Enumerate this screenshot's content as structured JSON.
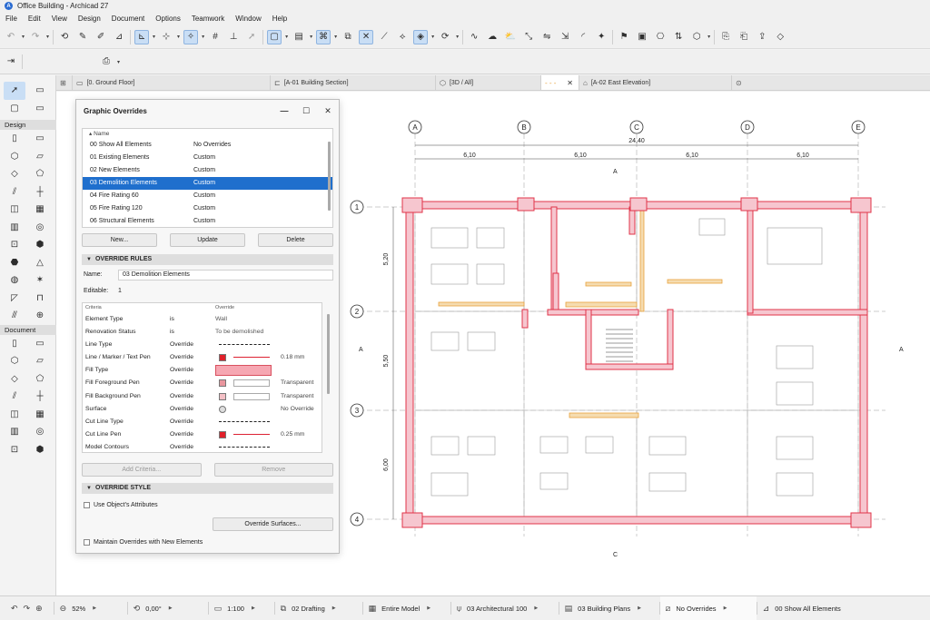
{
  "window": {
    "title": "Office Building - Archicad 27",
    "app_letter": "A"
  },
  "menu": [
    "File",
    "Edit",
    "View",
    "Design",
    "Document",
    "Options",
    "Teamwork",
    "Window",
    "Help"
  ],
  "toolbox": {
    "design_label": "Design",
    "document_label": "Document",
    "icons_top": [
      "arrow-pointer-icon",
      "marquee-icon",
      "rect-select-icon",
      "rect-select-alt-icon"
    ],
    "icons_design": [
      "wall-icon",
      "column-icon",
      "beam-icon",
      "slab-icon",
      "roof-icon",
      "shell-icon",
      "stair-icon",
      "railing-icon",
      "door-icon",
      "window-icon",
      "curtain-wall-icon",
      "skylight-icon",
      "opening-icon",
      "object-icon",
      "zone-icon",
      "mesh-icon",
      "morph-icon",
      "lamp-icon",
      "corner-window-icon",
      "wall-end-icon",
      "stair-alt-icon",
      "mep-icon"
    ],
    "icons_document": [
      "dimension-icon",
      "level-dim-icon",
      "radial-dim-icon",
      "angle-dim-icon",
      "text-icon",
      "label-icon",
      "line-icon",
      "arc-icon",
      "polyline-icon",
      "fill-icon",
      "spline-icon",
      "hotspot-icon",
      "figure-icon",
      "drawing-icon"
    ]
  },
  "tabs": [
    {
      "label": "[0. Ground Floor]",
      "icon": "floor-plan-icon"
    },
    {
      "label": "[A-01 Building Section]",
      "icon": "section-icon"
    },
    {
      "label": "[3D / All]",
      "icon": "cube-icon"
    },
    {
      "label": "",
      "icon": "overrides-tab-icon"
    },
    {
      "label": "[A-02 East Elevation]",
      "icon": "elevation-icon"
    }
  ],
  "dialog": {
    "title": "Graphic Overrides",
    "list_header": "Name",
    "rules": [
      {
        "name": "00 Show All Elements",
        "value": "No Overrides"
      },
      {
        "name": "01 Existing Elements",
        "value": "Custom"
      },
      {
        "name": "02 New Elements",
        "value": "Custom"
      },
      {
        "name": "03 Demolition Elements",
        "value": "Custom"
      },
      {
        "name": "04 Fire Rating 60",
        "value": "Custom"
      },
      {
        "name": "05 Fire Rating 120",
        "value": "Custom"
      },
      {
        "name": "06 Structural Elements",
        "value": "Custom"
      }
    ],
    "selected_index": 3,
    "buttons": {
      "new": "New...",
      "update": "Update",
      "delete": "Delete"
    },
    "override_rules_label": "OVERRIDE RULES",
    "name_label": "Name:",
    "name_value": "03 Demolition Elements",
    "editable_label": "Editable:",
    "editable_value": "1",
    "criteria_header": {
      "criteria": "Criteria",
      "override": "Override"
    },
    "criteria": [
      {
        "a": "Element Type",
        "b": "is",
        "c": "Wall",
        "d": ""
      },
      {
        "a": "Renovation Status",
        "b": "is",
        "c": "To be demolished",
        "d": ""
      },
      {
        "a": "Line Type",
        "b": "Override",
        "c": "",
        "d": ""
      },
      {
        "a": "Line / Marker / Text Pen",
        "b": "Override",
        "c": "",
        "d": "0.18  mm"
      },
      {
        "a": "Fill Type",
        "b": "Override",
        "c": "",
        "d": ""
      },
      {
        "a": "Fill Foreground Pen",
        "b": "Override",
        "c": "",
        "d": "Transparent"
      },
      {
        "a": "Fill Background Pen",
        "b": "Override",
        "c": "",
        "d": "Transparent"
      },
      {
        "a": "Surface",
        "b": "Override",
        "c": "",
        "d": "No Override"
      },
      {
        "a": "Cut Line Type",
        "b": "Override",
        "c": "",
        "d": ""
      },
      {
        "a": "Cut Line Pen",
        "b": "Override",
        "c": "",
        "d": "0.25  mm"
      },
      {
        "a": "Model Contours",
        "b": "Override",
        "c": "",
        "d": ""
      }
    ],
    "add_criteria": "Add Criteria...",
    "remove": "Remove",
    "override_style_label": "OVERRIDE STYLE",
    "use_object_attributes": "Use Object's Attributes",
    "override_surfaces": "Override Surfaces...",
    "maintain_overrides": "Maintain Overrides with New Elements"
  },
  "plan": {
    "grid_cols": [
      "A",
      "B",
      "C",
      "D",
      "E"
    ],
    "grid_rows": [
      "1",
      "2",
      "3",
      "4"
    ],
    "total_dim": "24,40",
    "col_dims": [
      "6,10",
      "6,10",
      "6,10",
      "6,10"
    ],
    "row_dims": [
      "5,20",
      "5,50",
      "6,00"
    ],
    "section_marker": "A",
    "section_marker_c": "C",
    "wall_red": "#e0344a",
    "wall_fill": "#f6c6cf",
    "existing_orange": "#e8a23c"
  },
  "status": {
    "zoom": "52%",
    "angle": "0,00°",
    "scale": "1:100",
    "layer": "02 Drafting",
    "model": "Entire Model",
    "pen_set": "03 Architectural 100",
    "view_set": "03 Building Plans",
    "overrides": "No Overrides",
    "show": "00 Show All Elements"
  }
}
